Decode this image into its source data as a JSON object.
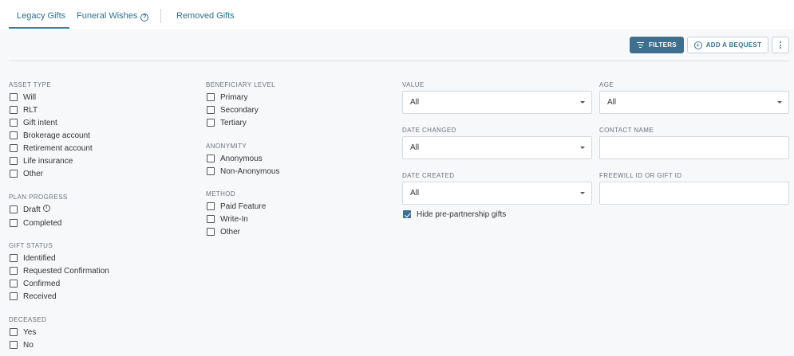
{
  "tabs": {
    "legacy_gifts": "Legacy Gifts",
    "funeral_wishes": "Funeral Wishes",
    "removed_gifts": "Removed Gifts"
  },
  "toolbar": {
    "filters_label": "FILTERS",
    "add_bequest_label": "ADD A BEQUEST"
  },
  "filters": {
    "asset_type": {
      "title": "ASSET TYPE",
      "options": [
        "Will",
        "RLT",
        "Gift intent",
        "Brokerage account",
        "Retirement account",
        "Life insurance",
        "Other"
      ]
    },
    "plan_progress": {
      "title": "PLAN PROGRESS",
      "options": [
        "Draft",
        "Completed"
      ]
    },
    "gift_status": {
      "title": "GIFT STATUS",
      "options": [
        "Identified",
        "Requested Confirmation",
        "Confirmed",
        "Received"
      ]
    },
    "deceased": {
      "title": "DECEASED",
      "options": [
        "Yes",
        "No"
      ]
    },
    "beneficiary_level": {
      "title": "BENEFICIARY LEVEL",
      "options": [
        "Primary",
        "Secondary",
        "Tertiary"
      ]
    },
    "anonymity": {
      "title": "ANONYMITY",
      "options": [
        "Anonymous",
        "Non-Anonymous"
      ]
    },
    "method": {
      "title": "METHOD",
      "options": [
        "Paid Feature",
        "Write-In",
        "Other"
      ]
    }
  },
  "fields": {
    "value": {
      "label": "VALUE",
      "selected": "All"
    },
    "age": {
      "label": "AGE",
      "selected": "All"
    },
    "date_changed": {
      "label": "DATE CHANGED",
      "selected": "All"
    },
    "contact_name": {
      "label": "CONTACT NAME",
      "value": "",
      "placeholder": ""
    },
    "date_created": {
      "label": "DATE CREATED",
      "selected": "All"
    },
    "freewill_id": {
      "label": "FREEWILL ID OR GIFT ID",
      "value": "",
      "placeholder": ""
    },
    "hide_pre_partnership": {
      "label": "Hide pre-partnership gifts",
      "checked": true
    }
  },
  "colors": {
    "accent": "#3f6f8f",
    "background": "#f7f8fa"
  }
}
